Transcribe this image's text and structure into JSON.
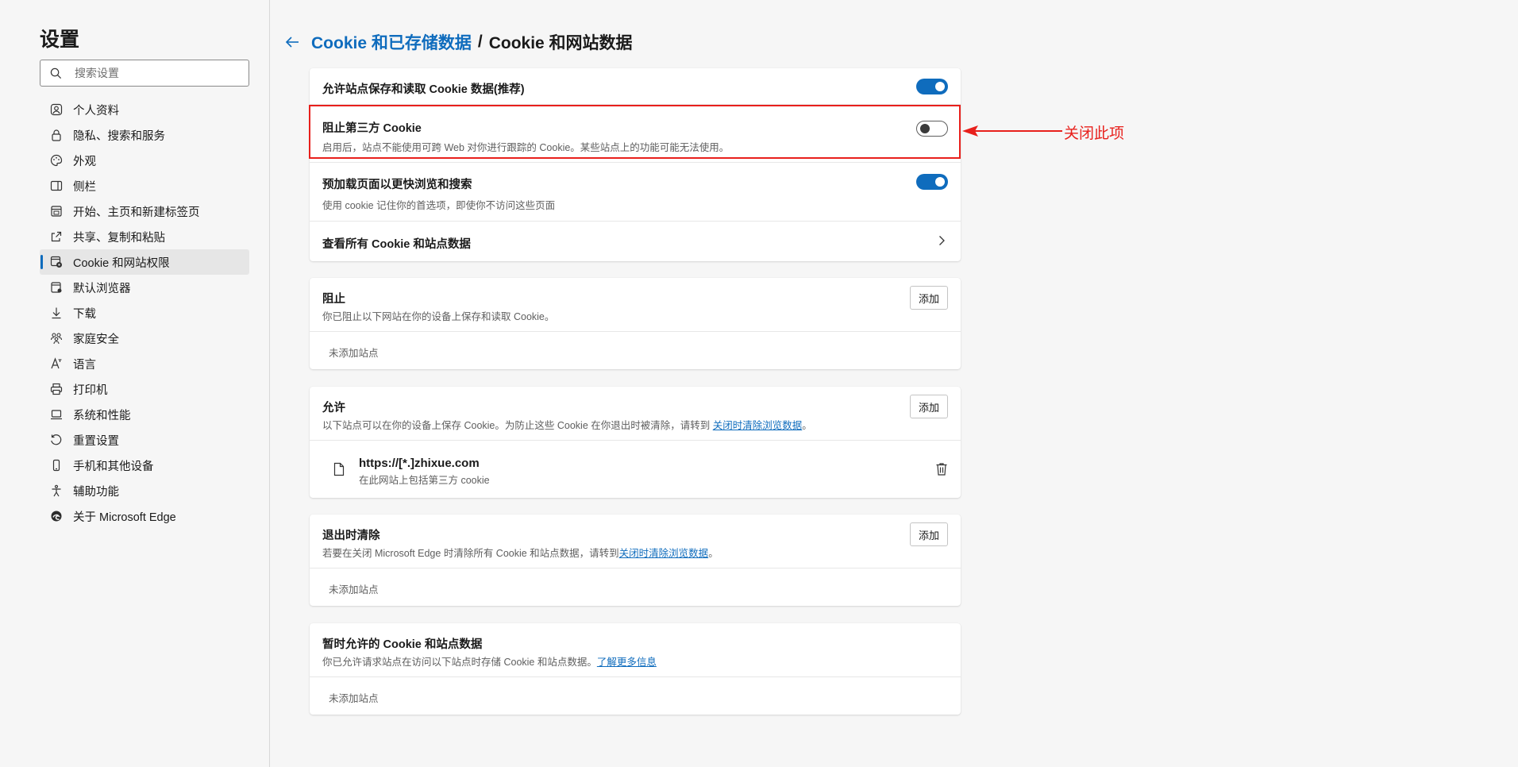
{
  "sidebar": {
    "title": "设置",
    "search_placeholder": "搜索设置",
    "items": [
      {
        "label": "个人资料",
        "icon": "profile-icon"
      },
      {
        "label": "隐私、搜索和服务",
        "icon": "lock-icon"
      },
      {
        "label": "外观",
        "icon": "palette-icon"
      },
      {
        "label": "侧栏",
        "icon": "sidebar-icon"
      },
      {
        "label": "开始、主页和新建标签页",
        "icon": "home-icon"
      },
      {
        "label": "共享、复制和粘贴",
        "icon": "share-icon"
      },
      {
        "label": "Cookie 和网站权限",
        "icon": "cookie-icon"
      },
      {
        "label": "默认浏览器",
        "icon": "browser-icon"
      },
      {
        "label": "下载",
        "icon": "download-icon"
      },
      {
        "label": "家庭安全",
        "icon": "family-icon"
      },
      {
        "label": "语言",
        "icon": "language-icon"
      },
      {
        "label": "打印机",
        "icon": "printer-icon"
      },
      {
        "label": "系统和性能",
        "icon": "laptop-icon"
      },
      {
        "label": "重置设置",
        "icon": "reset-icon"
      },
      {
        "label": "手机和其他设备",
        "icon": "phone-icon"
      },
      {
        "label": "辅助功能",
        "icon": "accessibility-icon"
      },
      {
        "label": "关于 Microsoft Edge",
        "icon": "edge-icon"
      }
    ],
    "active_index": 6
  },
  "header": {
    "parent": "Cookie 和已存储数据",
    "separator": "/",
    "current": "Cookie 和网站数据"
  },
  "settings": {
    "allow_cookies": {
      "title": "允许站点保存和读取 Cookie 数据(推荐)",
      "enabled": true
    },
    "block_third_party": {
      "title": "阻止第三方 Cookie",
      "subtitle": "启用后，站点不能使用可跨 Web 对你进行跟踪的 Cookie。某些站点上的功能可能无法使用。",
      "enabled": false
    },
    "preload": {
      "title": "预加载页面以更快浏览和搜索",
      "subtitle": "使用 cookie 记住你的首选项，即使你不访问这些页面",
      "enabled": true
    },
    "see_all": {
      "title": "查看所有 Cookie 和站点数据"
    }
  },
  "block": {
    "title": "阻止",
    "subtitle": "你已阻止以下网站在你的设备上保存和读取 Cookie。",
    "add_label": "添加",
    "empty": "未添加站点"
  },
  "allow": {
    "title": "允许",
    "subtitle_prefix": "以下站点可以在你的设备上保存 Cookie。为防止这些 Cookie 在你退出时被清除，请转到",
    "subtitle_link": "关闭时清除浏览数据",
    "subtitle_suffix": "。",
    "add_label": "添加",
    "site_url": "https://[*.]zhixue.com",
    "site_note": "在此网站上包括第三方 cookie"
  },
  "clear_on_exit": {
    "title": "退出时清除",
    "subtitle_prefix": "若要在关闭 Microsoft Edge 时清除所有 Cookie 和站点数据，请转到",
    "subtitle_link": "关闭时清除浏览数据",
    "subtitle_suffix": "。",
    "add_label": "添加",
    "empty": "未添加站点"
  },
  "temp_allowed": {
    "title": "暂时允许的 Cookie 和站点数据",
    "subtitle_prefix": "你已允许请求站点在访问以下站点时存储 Cookie 和站点数据。",
    "subtitle_link": "了解更多信息",
    "empty": "未添加站点"
  },
  "annotation": {
    "text": "关闭此项",
    "color": "#e8201c"
  },
  "colors": {
    "accent": "#0f6cbd",
    "annotation": "#e8201c"
  }
}
